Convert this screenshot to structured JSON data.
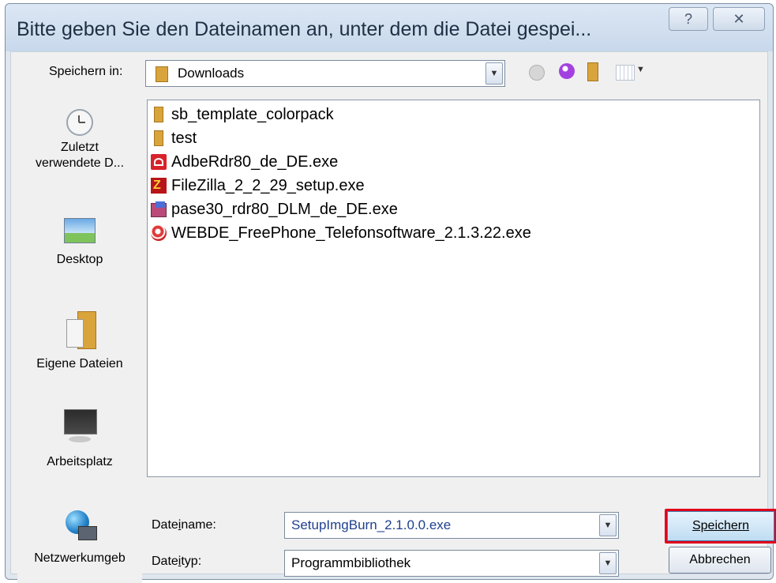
{
  "dialog": {
    "title": "Bitte geben Sie den Dateinamen an, unter dem die Datei gespei...",
    "help_glyph": "?",
    "close_glyph": "✕"
  },
  "toolbar": {
    "save_in_label": "Speichern in:",
    "save_in_value": "Downloads"
  },
  "places": [
    {
      "label": "Zuletzt",
      "label2": "verwendete D...",
      "icon": "recent-clock-icon"
    },
    {
      "label": "Desktop",
      "icon": "desktop-icon"
    },
    {
      "label": "Eigene Dateien",
      "icon": "my-documents-icon"
    },
    {
      "label": "Arbeitsplatz",
      "icon": "computer-icon"
    },
    {
      "label": "Netzwerkumgeb",
      "icon": "network-icon"
    }
  ],
  "files": [
    {
      "name": "sb_template_colorpack",
      "icon": "folder-icon"
    },
    {
      "name": "test",
      "icon": "folder-icon"
    },
    {
      "name": "AdbeRdr80_de_DE.exe",
      "icon": "adobe-reader-icon"
    },
    {
      "name": "FileZilla_2_2_29_setup.exe",
      "icon": "filezilla-icon"
    },
    {
      "name": "pase30_rdr80_DLM_de_DE.exe",
      "icon": "installer-icon"
    },
    {
      "name": "WEBDE_FreePhone_Telefonsoftware_2.1.3.22.exe",
      "icon": "webde-phone-icon"
    }
  ],
  "form": {
    "filename_label": "Dateiname:",
    "filename_value": "SetupImgBurn_2.1.0.0.exe",
    "filetype_label": "Dateityp:",
    "filetype_value": "Programmbibliothek",
    "save_button": "Speichern",
    "cancel_button": "Abbrechen"
  },
  "colors": {
    "highlight_border": "#e2001a",
    "folder": "#d9a43b"
  }
}
